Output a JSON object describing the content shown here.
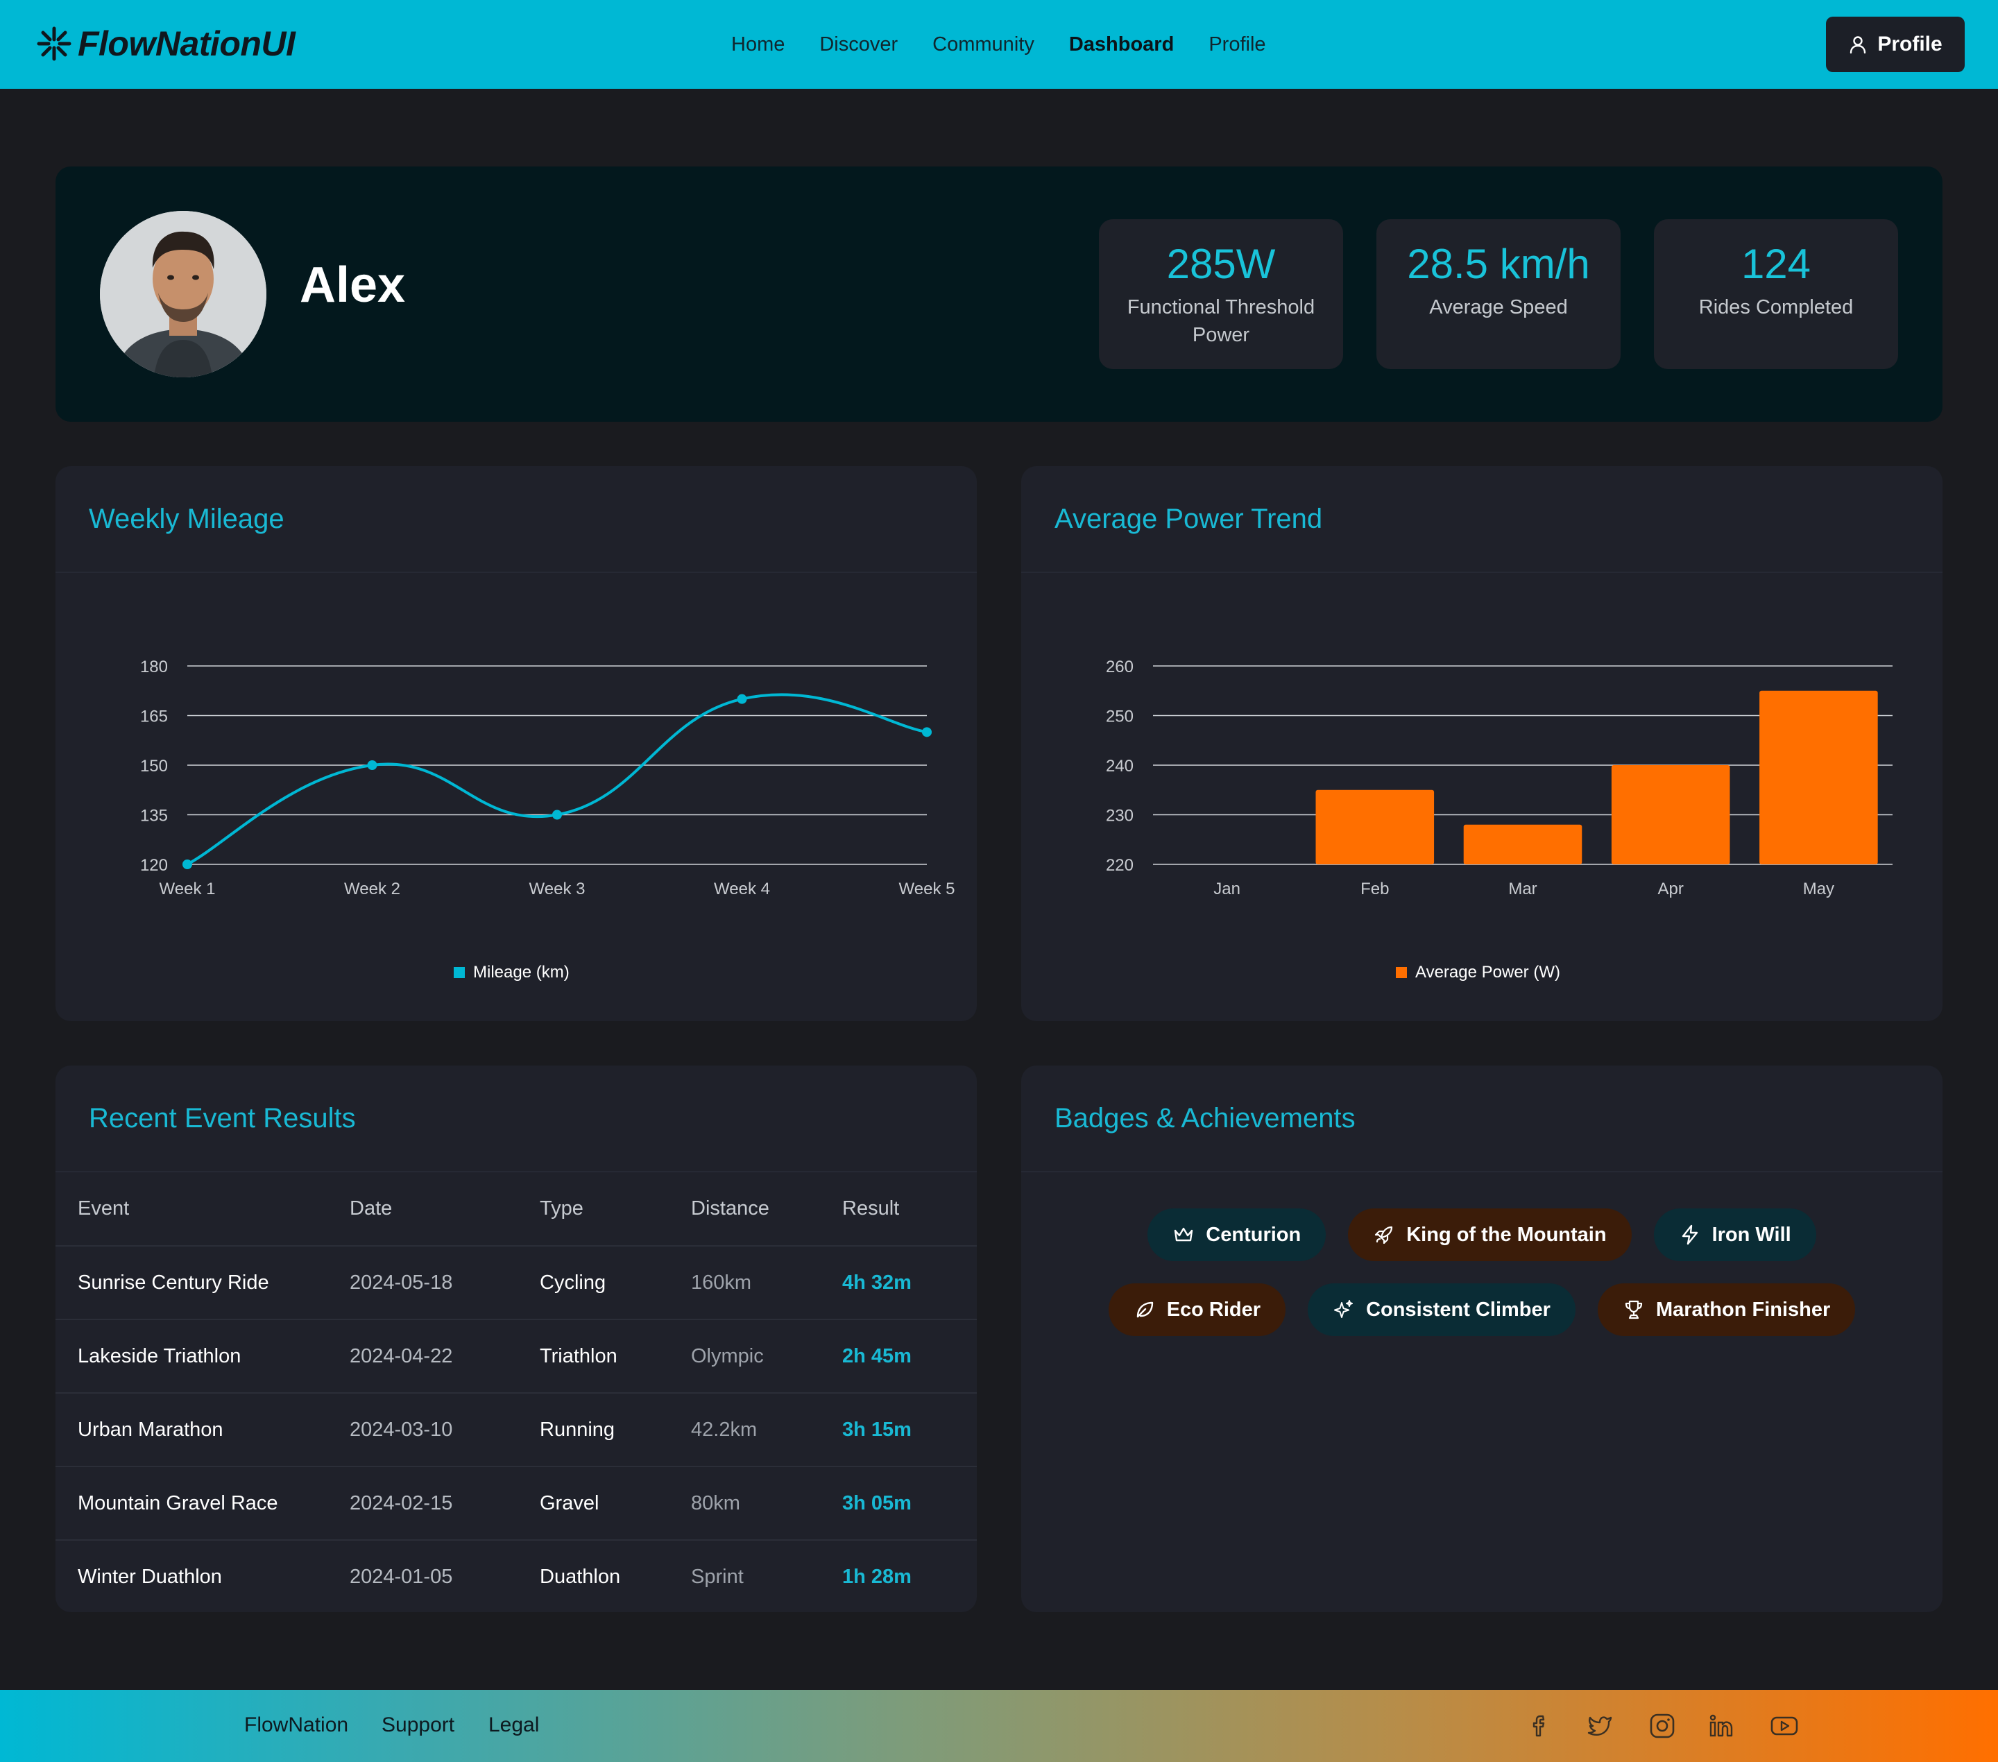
{
  "header": {
    "brand": "FlowNationUI",
    "nav": [
      "Home",
      "Discover",
      "Community",
      "Dashboard",
      "Profile"
    ],
    "active_nav": "Dashboard",
    "profile_button": "Profile",
    "bar_color": "#00b8d4"
  },
  "profile": {
    "name": "Alex",
    "stats": [
      {
        "value": "285W",
        "label": "Functional Threshold Power"
      },
      {
        "value": "28.5 km/h",
        "label": "Average Speed"
      },
      {
        "value": "124",
        "label": "Rides Completed"
      }
    ]
  },
  "mileage": {
    "title": "Weekly Mileage",
    "legend": "Mileage (km)",
    "y_ticks": [
      "180",
      "165",
      "150",
      "135",
      "120"
    ],
    "x_labels": [
      "Week 1",
      "Week 2",
      "Week 3",
      "Week 4",
      "Week 5"
    ]
  },
  "power": {
    "title": "Average Power Trend",
    "legend": "Average Power (W)",
    "y_ticks": [
      "260",
      "250",
      "240",
      "230",
      "220"
    ],
    "x_labels": [
      "Jan",
      "Feb",
      "Mar",
      "Apr",
      "May"
    ]
  },
  "chart_data": [
    {
      "type": "line",
      "title": "Weekly Mileage",
      "x": [
        "Week 1",
        "Week 2",
        "Week 3",
        "Week 4",
        "Week 5"
      ],
      "series": [
        {
          "name": "Mileage (km)",
          "values": [
            120,
            150,
            135,
            170,
            160
          ],
          "color": "#00b8d4"
        }
      ],
      "ylim": [
        120,
        180
      ],
      "grid": true,
      "legend_position": "bottom"
    },
    {
      "type": "bar",
      "title": "Average Power Trend",
      "categories": [
        "Jan",
        "Feb",
        "Mar",
        "Apr",
        "May"
      ],
      "series": [
        {
          "name": "Average Power (W)",
          "values": [
            220,
            235,
            228,
            240,
            255
          ],
          "color": "#ff6f00"
        }
      ],
      "ylim": [
        220,
        260
      ],
      "grid": true,
      "legend_position": "bottom"
    }
  ],
  "events": {
    "title": "Recent Event Results",
    "columns": [
      "Event",
      "Date",
      "Type",
      "Distance",
      "Result"
    ],
    "rows": [
      [
        "Sunrise Century Ride",
        "2024-05-18",
        "Cycling",
        "160km",
        "4h 32m"
      ],
      [
        "Lakeside Triathlon",
        "2024-04-22",
        "Triathlon",
        "Olympic",
        "2h 45m"
      ],
      [
        "Urban Marathon",
        "2024-03-10",
        "Running",
        "42.2km",
        "3h 15m"
      ],
      [
        "Mountain Gravel Race",
        "2024-02-15",
        "Gravel",
        "80km",
        "3h 05m"
      ],
      [
        "Winter Duathlon",
        "2024-01-05",
        "Duathlon",
        "Sprint",
        "1h 28m"
      ]
    ]
  },
  "badges": {
    "title": "Badges & Achievements",
    "items": [
      {
        "label": "Centurion",
        "icon": "crown-icon",
        "tone": "teal"
      },
      {
        "label": "King of the Mountain",
        "icon": "rocket-icon",
        "tone": "orange"
      },
      {
        "label": "Iron Will",
        "icon": "lightning-icon",
        "tone": "teal"
      },
      {
        "label": "Eco Rider",
        "icon": "leaf-icon",
        "tone": "orange"
      },
      {
        "label": "Consistent Climber",
        "icon": "sparkles-icon",
        "tone": "teal"
      },
      {
        "label": "Marathon Finisher",
        "icon": "trophy-icon",
        "tone": "orange"
      }
    ]
  },
  "footer": {
    "links": [
      "FlowNation",
      "Support",
      "Legal"
    ],
    "social_icons": [
      "facebook-icon",
      "twitter-icon",
      "instagram-icon",
      "linkedin-icon",
      "youtube-icon"
    ]
  }
}
